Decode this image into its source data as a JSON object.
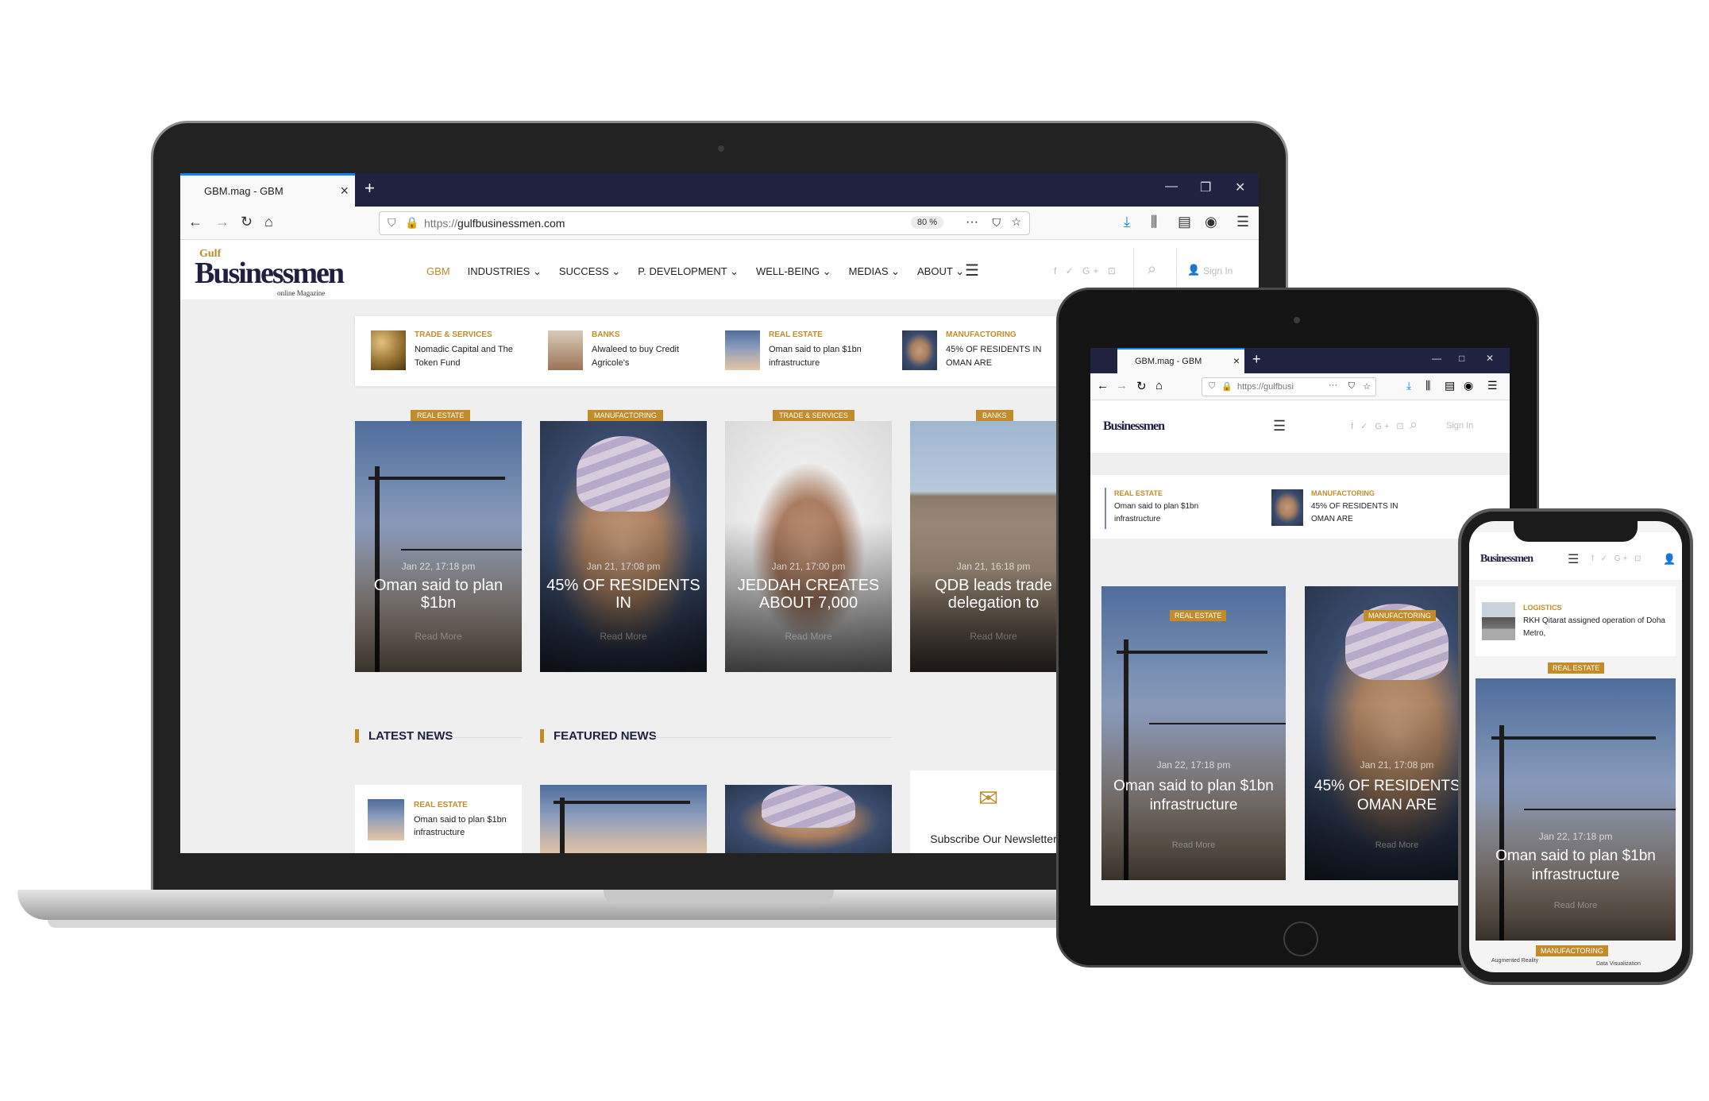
{
  "browser": {
    "tab_title": "GBM.mag - GBM",
    "url_proto": "https://",
    "url_host": "gulfbusinessmen.com",
    "url_short": "https://gulfbusi",
    "zoom": "80 %"
  },
  "site": {
    "logo_gulf": "Gulf",
    "logo_main": "Businessmen",
    "logo_sub": "online Magazine",
    "menu": [
      "GBM",
      "INDUSTRIES ⌄",
      "SUCCESS ⌄",
      "P. DEVELOPMENT ⌄",
      "WELL-BEING ⌄",
      "MEDIAS ⌄",
      "ABOUT ⌄"
    ],
    "social": "f ✓ G+ ⊡",
    "sign_in": "Sign In"
  },
  "ticker": [
    {
      "category": "TRADE & SERVICES",
      "title": "Nomadic Capital and The Token Fund"
    },
    {
      "category": "BANKS",
      "title": "Alwaleed to buy Credit Agricole's"
    },
    {
      "category": "REAL ESTATE",
      "title": "Oman said to plan $1bn infrastructure"
    },
    {
      "category": "MANUFACTORING",
      "title": "45% OF RESIDENTS IN OMAN ARE"
    }
  ],
  "cards": [
    {
      "category": "REAL ESTATE",
      "date": "Jan 22, 17:18 pm",
      "title": "Oman said to plan $1bn",
      "more": "Read More"
    },
    {
      "category": "MANUFACTORING",
      "date": "Jan 21, 17:08 pm",
      "title": "45% OF RESIDENTS IN",
      "more": "Read More"
    },
    {
      "category": "TRADE & SERVICES",
      "date": "Jan 21, 17:00 pm",
      "title": "JEDDAH CREATES ABOUT 7,000",
      "more": "Read More"
    },
    {
      "category": "BANKS",
      "date": "Jan 21, 16:18 pm",
      "title": "QDB leads trade delegation to",
      "more": "Read More"
    }
  ],
  "sections": {
    "latest": "LATEST NEWS",
    "featured": "FEATURED NEWS"
  },
  "latest_item": {
    "category": "REAL ESTATE",
    "title": "Oman said to plan $1bn infrastructure"
  },
  "newsletter": "Subscribe Our Newsletter",
  "tablet": {
    "ticker": [
      {
        "category": "REAL ESTATE",
        "title": "Oman said to plan $1bn infrastructure"
      },
      {
        "category": "MANUFACTORING",
        "title": "45% OF RESIDENTS IN OMAN ARE"
      }
    ],
    "cards": [
      {
        "category": "REAL ESTATE",
        "date": "Jan 22, 17:18 pm",
        "title": "Oman said to plan $1bn infrastructure",
        "more": "Read More"
      },
      {
        "category": "MANUFACTORING",
        "date": "Jan 21, 17:08 pm",
        "title": "45% OF RESIDENTS IN OMAN ARE",
        "more": "Read More"
      }
    ]
  },
  "phone": {
    "ticker": {
      "category": "LOGISTICS",
      "title": "RKH Qitarat assigned operation of Doha Metro,"
    },
    "card": {
      "category": "REAL ESTATE",
      "date": "Jan 22, 17:18 pm",
      "title": "Oman said to plan $1bn infrastructure",
      "more": "Read More"
    },
    "next_category": "MANUFACTORING",
    "footer_left": "Augmented Reality",
    "footer_right": "Data Visualization"
  }
}
